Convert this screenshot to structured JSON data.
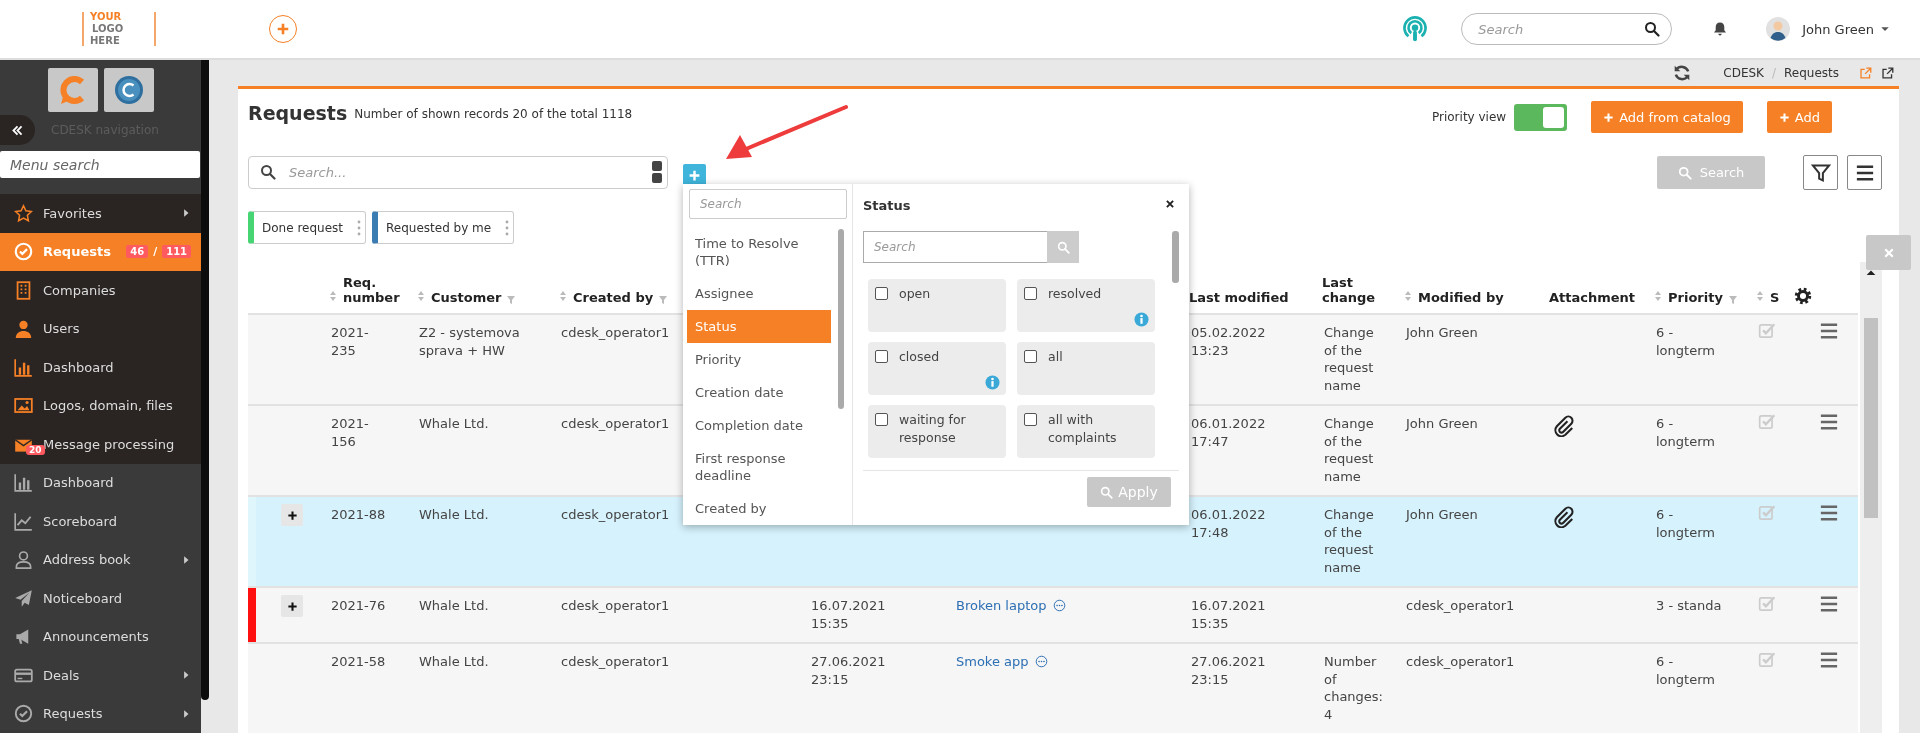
{
  "header": {
    "logo": {
      "word_1": "YOUR",
      "word_2": "LOGO",
      "word_3": "HERE"
    },
    "search": {
      "placeholder": "Search"
    },
    "user": {
      "name": "John Green"
    }
  },
  "sidebar": {
    "title": "CDESK navigation",
    "search": {
      "placeholder": "Menu search"
    },
    "sections": [
      {
        "items": [
          {
            "label": "Favorites",
            "selected": false,
            "submenu": true
          },
          {
            "label": "Requests",
            "selected": true,
            "submenu": false,
            "counts": [
              "46",
              "111"
            ],
            "count_separator": "/"
          },
          {
            "label": "Companies",
            "selected": false,
            "submenu": false
          },
          {
            "label": "Users",
            "selected": false,
            "submenu": false
          },
          {
            "label": "Dashboard",
            "selected": false,
            "submenu": false
          },
          {
            "label": "Logos, domain, files",
            "selected": false,
            "submenu": false
          },
          {
            "label": "Message processing",
            "selected": false,
            "submenu": false,
            "badge": "20"
          }
        ]
      },
      {
        "items": [
          {
            "label": "Dashboard",
            "selected": false,
            "submenu": false
          },
          {
            "label": "Scoreboard",
            "selected": false,
            "submenu": false
          },
          {
            "label": "Address book",
            "selected": false,
            "submenu": true
          },
          {
            "label": "Noticeboard",
            "selected": false,
            "submenu": false
          },
          {
            "label": "Announcements",
            "selected": false,
            "submenu": false
          },
          {
            "label": "Deals",
            "selected": false,
            "submenu": true
          },
          {
            "label": "Requests",
            "selected": false,
            "submenu": true
          }
        ]
      }
    ]
  },
  "breadcrumb": {
    "items": [
      "CDESK",
      "Requests"
    ],
    "separator": "/"
  },
  "page": {
    "title": "Requests",
    "subtitle": "Number of shown records 20 of the total 1118",
    "priority_view": {
      "label": "Priority view",
      "on": true
    },
    "actions": [
      {
        "label": "Add from catalog"
      },
      {
        "label": "Add"
      }
    ],
    "search": {
      "placeholder": "Search..."
    },
    "search_button": {
      "label": "Search",
      "disabled": true
    },
    "saved_filters": [
      {
        "label": "Done request",
        "color": "#47d574"
      },
      {
        "label": "Requested by me",
        "color": "#3b7db3"
      }
    ]
  },
  "filter_popup": {
    "search": {
      "placeholder": "Search"
    },
    "fields": [
      {
        "label": "Time to Resolve (TTR)",
        "selected": false
      },
      {
        "label": "Assignee",
        "selected": false
      },
      {
        "label": "Status",
        "selected": true
      },
      {
        "label": "Priority",
        "selected": false
      },
      {
        "label": "Creation date",
        "selected": false
      },
      {
        "label": "Completion date",
        "selected": false
      },
      {
        "label": "First response deadline",
        "selected": false
      },
      {
        "label": "Created by",
        "selected": false
      }
    ],
    "panel": {
      "title": "Status",
      "search": {
        "placeholder": "Search"
      },
      "options": [
        {
          "label": "open",
          "checked": false,
          "info": false
        },
        {
          "label": "resolved",
          "checked": false,
          "info": true
        },
        {
          "label": "closed",
          "checked": false,
          "info": true
        },
        {
          "label": "all",
          "checked": false,
          "info": false
        },
        {
          "label": "waiting for response",
          "checked": false,
          "info": false
        },
        {
          "label": "all with complaints",
          "checked": false,
          "info": false
        }
      ],
      "apply": {
        "label": "Apply",
        "disabled": true
      }
    }
  },
  "table": {
    "columns": [
      {
        "label": "Req. number",
        "sortable": true,
        "filterable": false
      },
      {
        "label": "Customer",
        "sortable": true,
        "filterable": true
      },
      {
        "label": "Created by",
        "sortable": true,
        "filterable": true
      },
      {
        "label": "Last modified",
        "sortable": false,
        "filterable": false
      },
      {
        "label": "Last change",
        "sortable": false,
        "filterable": false
      },
      {
        "label": "Modified by",
        "sortable": true,
        "filterable": false
      },
      {
        "label": "Attachment",
        "sortable": false,
        "filterable": false
      },
      {
        "label": "Priority",
        "sortable": true,
        "filterable": true
      },
      {
        "label": "S",
        "sortable": true,
        "filterable": false
      }
    ],
    "rows": [
      {
        "req_number": "2021-235",
        "customer": "Z2 - systemova sprava + HW",
        "created_by": "cdesk_operator1",
        "last_modified": "05.02.2022 13:23",
        "last_change": "Change of the request name",
        "modified_by": "John Green",
        "attachment": false,
        "priority": "6 - longterm",
        "expandable": false,
        "flagged": false,
        "selected": false
      },
      {
        "req_number": "2021-156",
        "customer": "Whale Ltd.",
        "created_by": "cdesk_operator1",
        "last_modified": "06.01.2022 17:47",
        "last_change": "Change of the request name",
        "modified_by": "John Green",
        "attachment": true,
        "priority": "6 - longterm",
        "expandable": false,
        "flagged": false,
        "selected": false
      },
      {
        "req_number": "2021-88",
        "customer": "Whale Ltd.",
        "created_by": "cdesk_operator1",
        "last_modified": "06.01.2022 17:48",
        "last_change": "Change of the request name",
        "modified_by": "John Green",
        "attachment": true,
        "priority": "6 - longterm",
        "expandable": true,
        "flagged": false,
        "selected": true
      },
      {
        "req_number": "2021-76",
        "customer": "Whale Ltd.",
        "created_by": "cdesk_operator1",
        "column_4": "16.07.2021 15:35",
        "column_5": "Broken laptop",
        "last_modified": "16.07.2021 15:35",
        "modified_by": "cdesk_operator1",
        "attachment": false,
        "priority": "3 - standa",
        "expandable": true,
        "flagged": true,
        "selected": false
      },
      {
        "req_number": "2021-58",
        "customer": "Whale Ltd.",
        "created_by": "cdesk_operator1",
        "column_4": "27.06.2021 23:15",
        "column_5": "Smoke app",
        "last_modified": "27.06.2021 23:15",
        "last_change": "Number of changes: 4",
        "modified_by": "cdesk_operator1",
        "attachment": false,
        "priority": "6 - longterm",
        "expandable": false,
        "flagged": false,
        "selected": false
      }
    ]
  }
}
